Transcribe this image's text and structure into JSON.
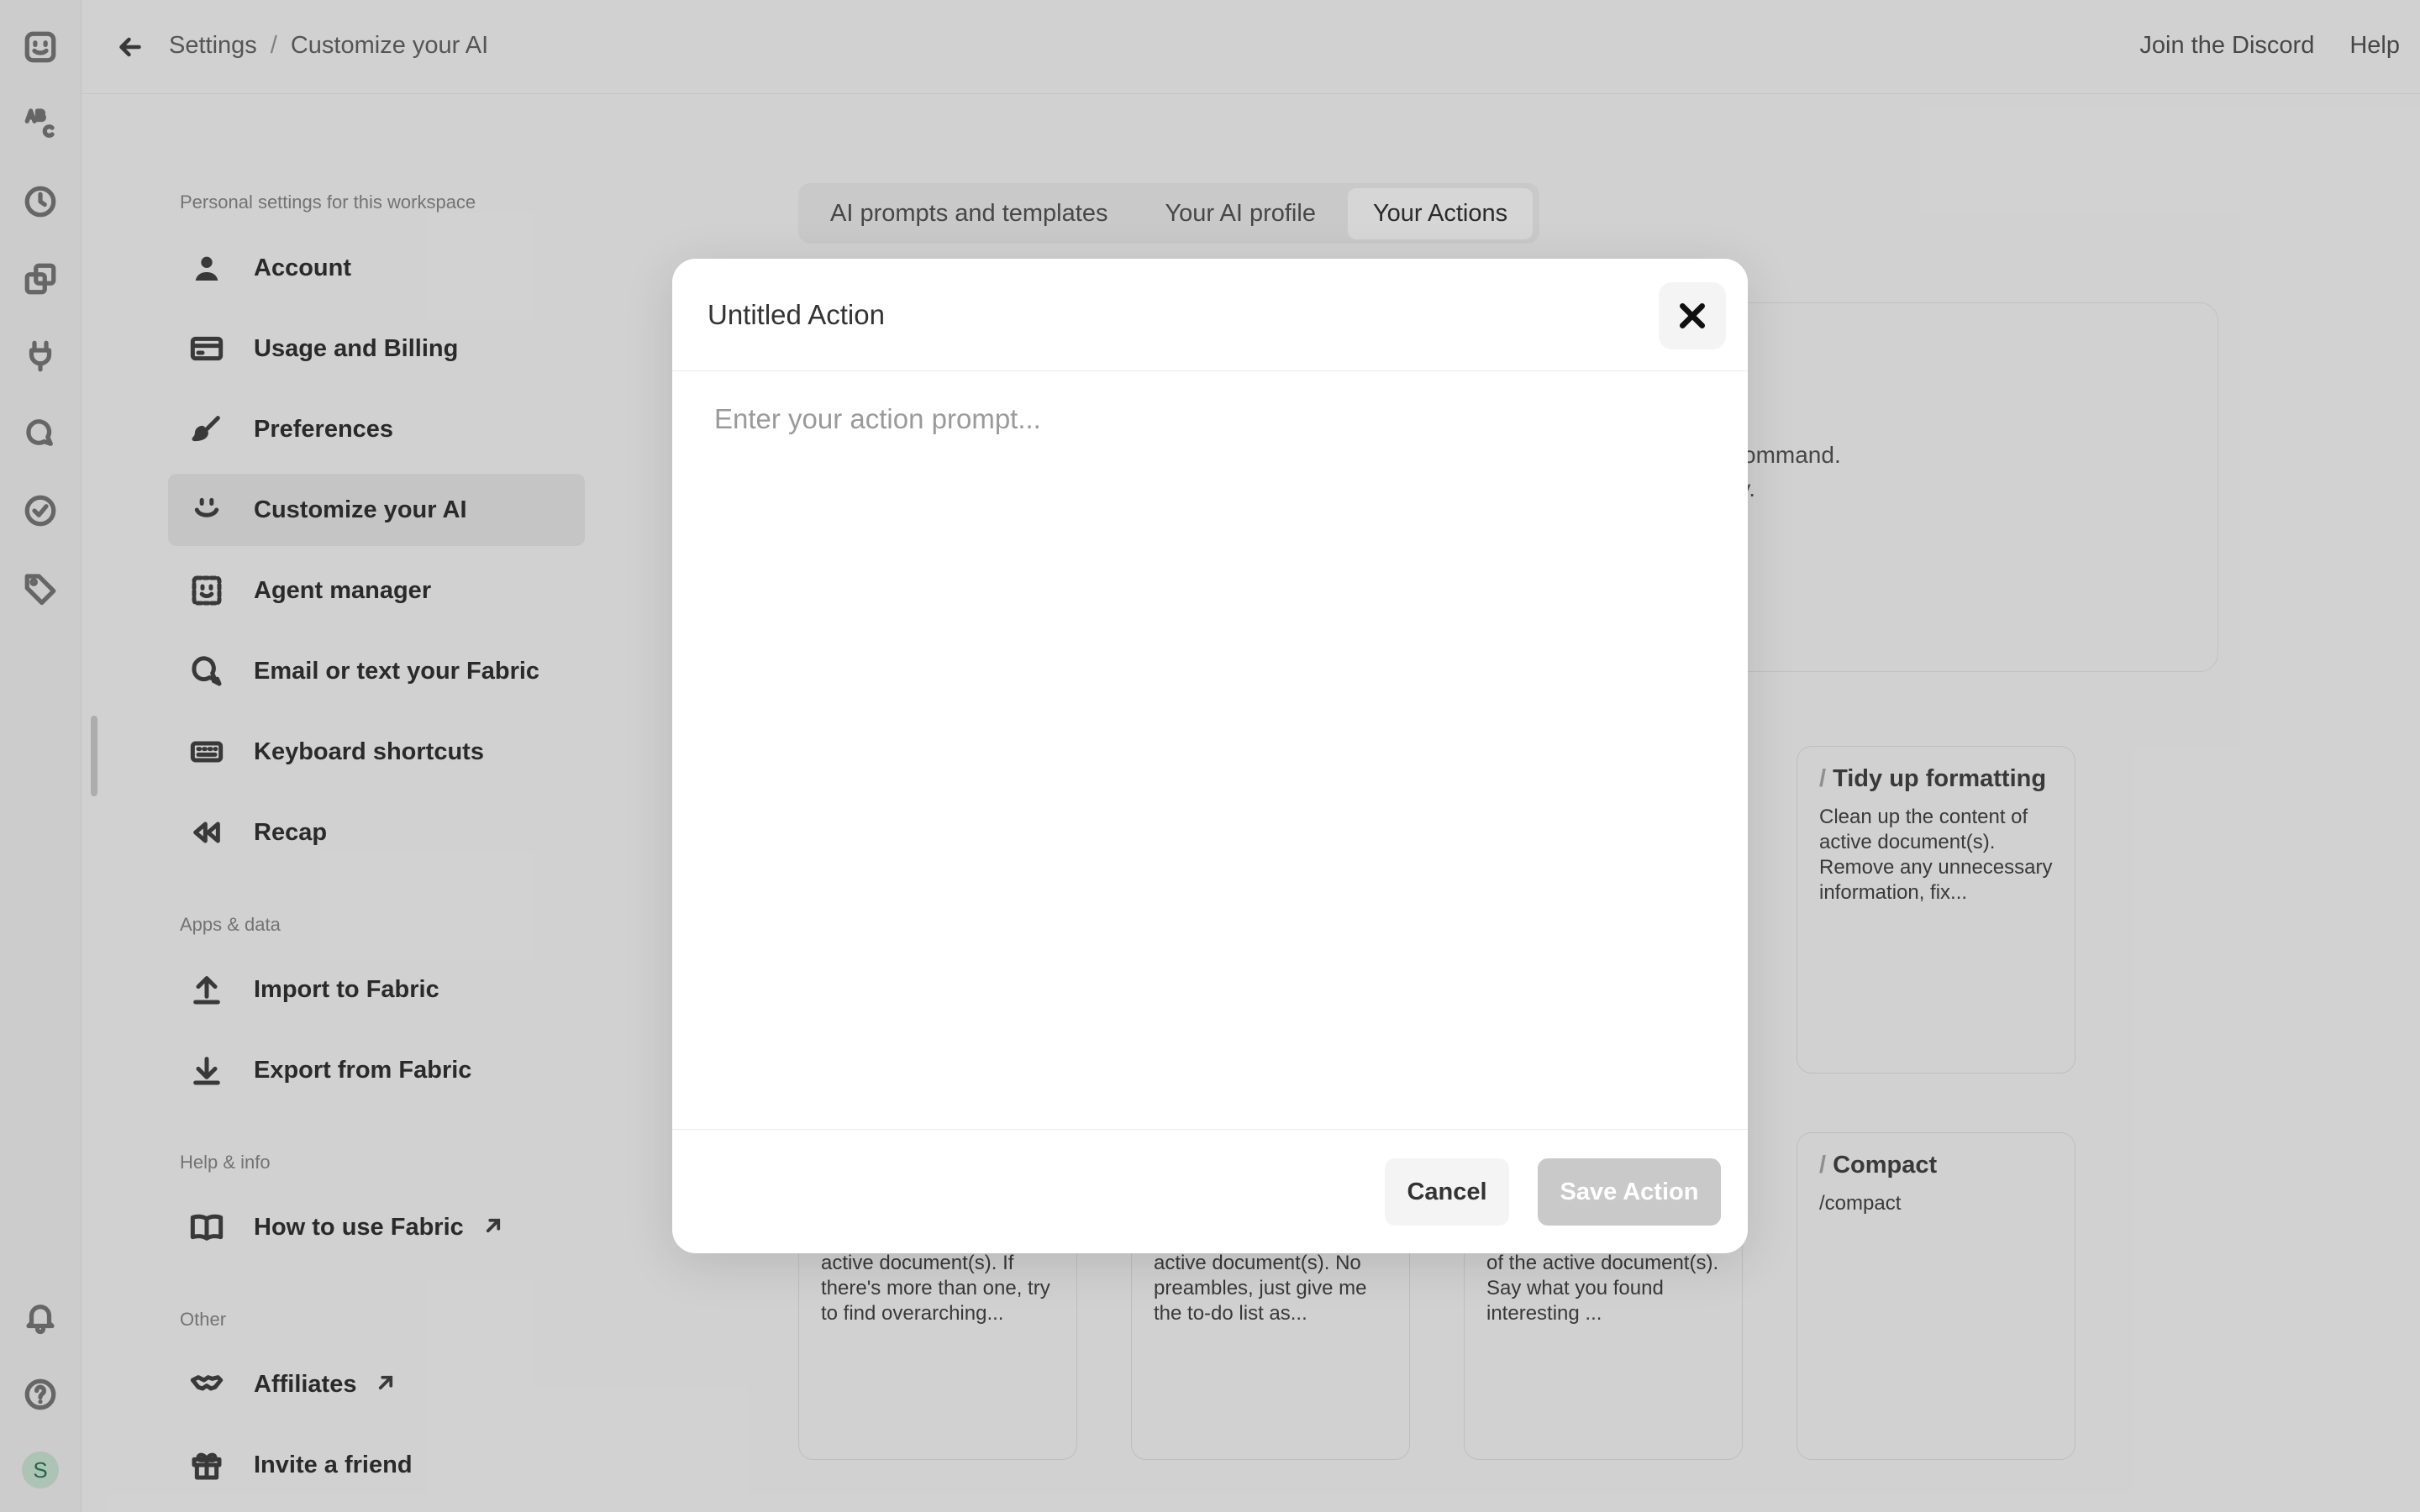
{
  "header": {
    "breadcrumb": [
      "Settings",
      "Customize your AI"
    ],
    "separator": "/",
    "links": {
      "discord": "Join the Discord",
      "help": "Help"
    }
  },
  "rail": {
    "icons": [
      "fabric-logo-icon",
      "abc-icon",
      "clock-icon",
      "copy-icon",
      "plug-icon",
      "chat-icon",
      "check-circle-icon",
      "tag-icon",
      "bell-icon",
      "help-circle-icon"
    ],
    "avatar_initial": "S"
  },
  "sidebar": {
    "sections": {
      "personal": "Personal settings for this workspace",
      "apps": "Apps & data",
      "help": "Help & info",
      "other": "Other"
    },
    "items": [
      {
        "label": "Account",
        "icon": "person-icon"
      },
      {
        "label": "Usage and Billing",
        "icon": "credit-card-icon"
      },
      {
        "label": "Preferences",
        "icon": "brush-icon"
      },
      {
        "label": "Customize your AI",
        "icon": "smile-face-icon",
        "active": true
      },
      {
        "label": "Agent manager",
        "icon": "agent-face-icon"
      },
      {
        "label": "Email or text your Fabric",
        "icon": "chat-bubbles-icon"
      },
      {
        "label": "Keyboard shortcuts",
        "icon": "keyboard-icon"
      },
      {
        "label": "Recap",
        "icon": "rewind-icon"
      },
      {
        "label": "Import to Fabric",
        "icon": "upload-icon"
      },
      {
        "label": "Export from Fabric",
        "icon": "download-icon"
      },
      {
        "label": "How to use Fabric",
        "icon": "book-icon",
        "external": true
      },
      {
        "label": "Affiliates",
        "icon": "handshake-icon",
        "external": true
      },
      {
        "label": "Invite a friend",
        "icon": "gift-icon"
      }
    ]
  },
  "tabs": [
    {
      "label": "AI prompts and templates"
    },
    {
      "label": "Your AI profile"
    },
    {
      "label": "Your Actions",
      "active": true
    }
  ],
  "background": {
    "desc_line1": "command.",
    "desc_line2": "ry.",
    "cards": [
      {
        "title": "Tidy up formatting",
        "text": "Clean up the content of active document(s). Remove any unnecessary information, fix..."
      },
      {
        "title": "Compact",
        "text": "/compact"
      },
      {
        "title": "",
        "text": "active document(s). If there's more than one, try to find overarching..."
      },
      {
        "title": "",
        "text": "active document(s). No preambles, just give me the to-do list as..."
      },
      {
        "title": "",
        "text": "of the active document(s). Say what you found interesting ..."
      }
    ]
  },
  "modal": {
    "title": "Untitled Action",
    "prompt_placeholder": "Enter your action prompt...",
    "prompt_value": "",
    "cancel_label": "Cancel",
    "save_label": "Save Action"
  }
}
